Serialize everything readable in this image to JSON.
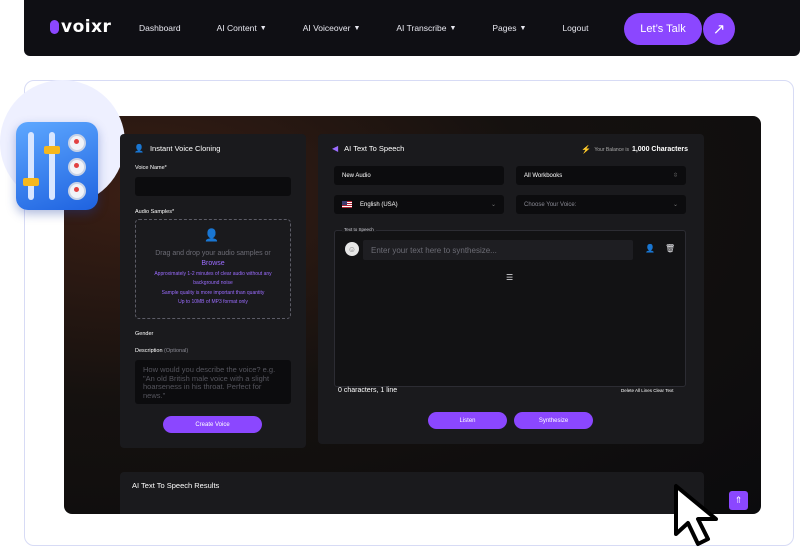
{
  "brand": {
    "logo_text": "voixr",
    "accent": "#8b47ff"
  },
  "nav": {
    "items": [
      {
        "label": "Dashboard",
        "has_dropdown": false
      },
      {
        "label": "AI Content",
        "has_dropdown": true
      },
      {
        "label": "AI Voiceover",
        "has_dropdown": true
      },
      {
        "label": "AI Transcribe",
        "has_dropdown": true
      },
      {
        "label": "Pages",
        "has_dropdown": true
      },
      {
        "label": "Logout",
        "has_dropdown": false
      }
    ],
    "cta_label": "Let’s Talk",
    "cta_icon": "arrow-up-right-icon"
  },
  "cloning": {
    "title": "Instant Voice Cloning",
    "voice_name_label": "Voice Name",
    "required_mark": "*",
    "audio_samples_label": "Audio Samples",
    "drop_main": "Drag and drop your audio samples or",
    "browse": "Browse",
    "hint1": "Approximately 1-2 minutes of clear audio without any",
    "hint2": "background noise",
    "hint3": "Sample quality is more important than quantity",
    "hint4": "Up to 10MB of MP3 format only",
    "gender_label": "Gender",
    "description_label": "Description",
    "optional": "(Optional)",
    "description_placeholder": "How would you describe the voice? e.g. \"An old British male voice with a slight hoarseness in his throat. Perfect for news.\"",
    "create_button": "Create Voice"
  },
  "tts": {
    "title": "AI Text To Speech",
    "balance_prefix": "Your Balance is",
    "balance_value": "1,000 Characters",
    "audio_name": "New Audio",
    "workbook_select": "All Workbooks",
    "language": "English (USA)",
    "voice_select": "Choose Your Voice:",
    "box_label": "Text to Speech",
    "text_placeholder": "Enter your text here to synthesize...",
    "count_text": "0 characters, 1 line",
    "delete_lines": "Delete All Lines",
    "clear_text": "Clear Text",
    "listen_button": "Listen",
    "synthesize_button": "Synthesize"
  },
  "results": {
    "title": "AI Text To Speech Results"
  }
}
